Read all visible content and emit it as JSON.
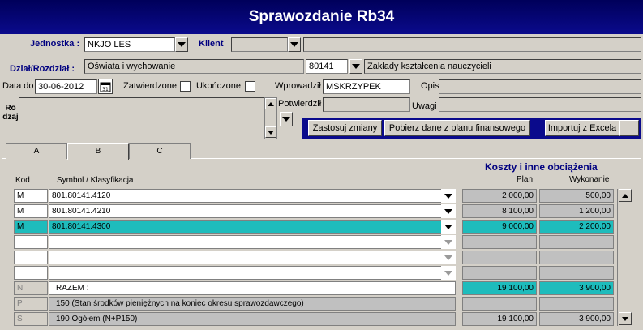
{
  "title": "Sprawozdanie Rb34",
  "jednostka": {
    "label": "Jednostka :",
    "value": "NKJO LES"
  },
  "klient": {
    "label": "Klient",
    "value": "",
    "name": ""
  },
  "dzial": {
    "label": "Dział/Rozdział :",
    "value": "Oświata i wychowanie",
    "rozdzial_code": "80141",
    "rozdzial_name": "Zakłady kształcenia nauczycieli"
  },
  "data_do": {
    "label": "Data do",
    "value": "30-06-2012"
  },
  "zatwierdzone_label": "Zatwierdzone",
  "ukonczone_label": "Ukończone",
  "wprowadzil": {
    "label": "Wprowadził",
    "value": "MSKRZYPEK"
  },
  "potwierdzil": {
    "label": "Potwierdził",
    "value": ""
  },
  "opis": {
    "label": "Opis",
    "value": ""
  },
  "uwagi": {
    "label": "Uwagi",
    "value": ""
  },
  "rodzaj_label": "Ro dzaj",
  "buttons": {
    "apply": "Zastosuj zmiany",
    "fetch": "Pobierz dane  z planu finansowego",
    "import": "Importuj z Excela"
  },
  "tabs": [
    "A",
    "B",
    "C"
  ],
  "section_title": "Koszty i inne obciążenia",
  "columns": {
    "kod": "Kod",
    "symbol": "Symbol / Klasyfikacja",
    "plan": "Plan",
    "wykonanie": "Wykonanie"
  },
  "rows": [
    {
      "kod": "M",
      "symbol": "801.80141.4120",
      "plan": "2 000,00",
      "wykonanie": "500,00"
    },
    {
      "kod": "M",
      "symbol": "801.80141.4210",
      "plan": "8 100,00",
      "wykonanie": "1 200,00"
    },
    {
      "kod": "M",
      "symbol": "801.80141.4300",
      "plan": "9 000,00",
      "wykonanie": "2 200,00"
    },
    {
      "kod": "",
      "symbol": "",
      "plan": "",
      "wykonanie": ""
    },
    {
      "kod": "",
      "symbol": "",
      "plan": "",
      "wykonanie": ""
    },
    {
      "kod": "",
      "symbol": "",
      "plan": "",
      "wykonanie": ""
    }
  ],
  "summary": [
    {
      "kod": "N",
      "label": "RAZEM :",
      "plan": "19 100,00",
      "wykonanie": "3 900,00"
    },
    {
      "kod": "P",
      "label": "150 (Stan środków pieniężnych na koniec okresu sprawozdawczego)",
      "plan": "",
      "wykonanie": ""
    },
    {
      "kod": "S",
      "label": "190 Ogółem (N+P150)",
      "plan": "19 100,00",
      "wykonanie": "3 900,00"
    }
  ],
  "colors": {
    "title_bg": "#0a0a8c",
    "highlight": "#1ebcbc",
    "label_blue": "#000080"
  }
}
